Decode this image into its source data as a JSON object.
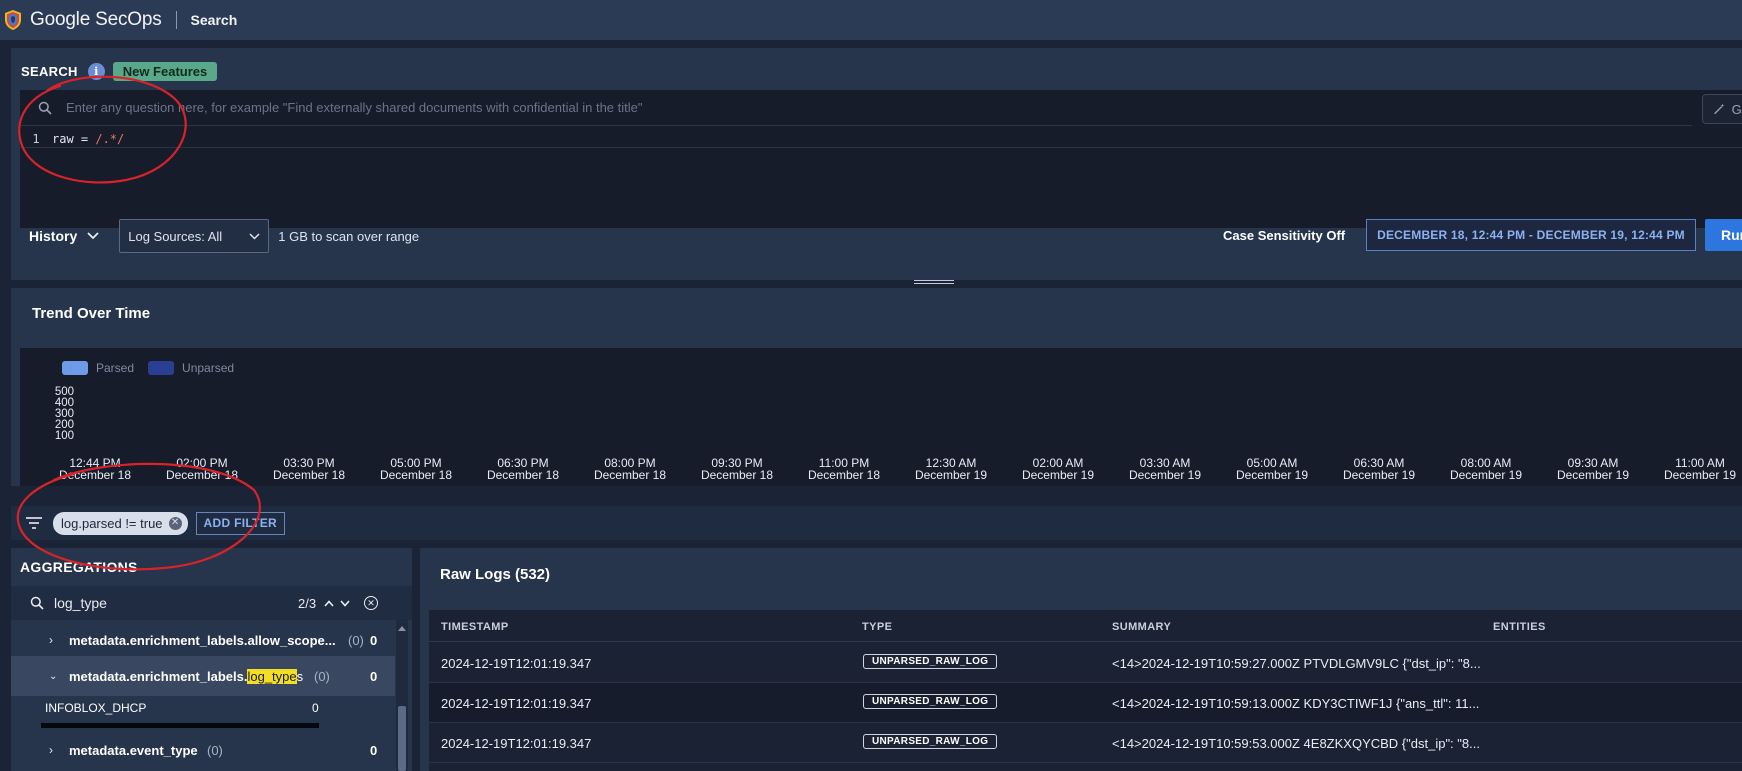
{
  "app": {
    "brand": "Google SecOps",
    "page": "Search",
    "logo_icon": "secops-shield-icon"
  },
  "search": {
    "title": "SEARCH",
    "new_features_label": "New Features",
    "nl_placeholder": "Enter any question here, for example \"Find externally shared documents with confidential in the title\"",
    "generate_label": "Ge",
    "code_line_number": "1",
    "code_prefix": "raw = ",
    "code_regex": "/.*/",
    "history_label": "History",
    "log_sources_label": "Log Sources: All",
    "scan_text": "1 GB to scan over range",
    "case_sensitivity_label": "Case Sensitivity Off",
    "range_label": "DECEMBER 18, 12:44 PM - DECEMBER 19, 12:44 PM",
    "run_label": "Run"
  },
  "trend": {
    "title": "Trend Over Time",
    "legend": [
      {
        "label": "Parsed",
        "color": "#6f9ae8"
      },
      {
        "label": "Unparsed",
        "color": "#2c3e94"
      }
    ],
    "y_ticks": [
      "500",
      "400",
      "300",
      "200",
      "100"
    ],
    "x_ticks": [
      {
        "time": "12:44 PM",
        "date": "December 18"
      },
      {
        "time": "02:00 PM",
        "date": "December 18"
      },
      {
        "time": "03:30 PM",
        "date": "December 18"
      },
      {
        "time": "05:00 PM",
        "date": "December 18"
      },
      {
        "time": "06:30 PM",
        "date": "December 18"
      },
      {
        "time": "08:00 PM",
        "date": "December 18"
      },
      {
        "time": "09:30 PM",
        "date": "December 18"
      },
      {
        "time": "11:00 PM",
        "date": "December 18"
      },
      {
        "time": "12:30 AM",
        "date": "December 19"
      },
      {
        "time": "02:00 AM",
        "date": "December 19"
      },
      {
        "time": "03:30 AM",
        "date": "December 19"
      },
      {
        "time": "05:00 AM",
        "date": "December 19"
      },
      {
        "time": "06:30 AM",
        "date": "December 19"
      },
      {
        "time": "08:00 AM",
        "date": "December 19"
      },
      {
        "time": "09:30 AM",
        "date": "December 19"
      },
      {
        "time": "11:00 AM",
        "date": "December 19"
      }
    ]
  },
  "filters": {
    "chips": [
      {
        "label": "log.parsed != true"
      }
    ],
    "add_filter_label": "ADD FILTER"
  },
  "aggregations": {
    "title": "AGGREGATIONS",
    "search_value": "log_type",
    "match_count": "2/3",
    "rows": [
      {
        "name": "metadata.enrichment_labels.allow_scope...",
        "count": "(0)",
        "value": "0",
        "expanded": false
      },
      {
        "name_prefix": "metadata.enrichment_labels.",
        "name_highlight": "log_type",
        "name_suffix": "s",
        "count": "(0)",
        "value": "0",
        "expanded": true
      },
      {
        "name": "INFOBLOX_DHCP",
        "value": "0",
        "child": true
      },
      {
        "name": "metadata.event_type",
        "count": "(0)",
        "value": "0",
        "expanded": false
      }
    ]
  },
  "raw_logs": {
    "title": "Raw Logs (532)",
    "columns": [
      "TIMESTAMP",
      "TYPE",
      "SUMMARY",
      "ENTITIES"
    ],
    "rows": [
      {
        "timestamp": "2024-12-19T12:01:19.347",
        "type": "UNPARSED_RAW_LOG",
        "summary": "<14>2024-12-19T10:59:27.000Z PTVDLGMV9LC {\"dst_ip\": \"8..."
      },
      {
        "timestamp": "2024-12-19T12:01:19.347",
        "type": "UNPARSED_RAW_LOG",
        "summary": "<14>2024-12-19T10:59:13.000Z KDY3CTIWF1J {\"ans_ttl\": 11..."
      },
      {
        "timestamp": "2024-12-19T12:01:19.347",
        "type": "UNPARSED_RAW_LOG",
        "summary": "<14>2024-12-19T10:59:53.000Z 4E8ZKXQYCBD {\"dst_ip\": \"8..."
      }
    ]
  },
  "annotation_color": "#d8232a"
}
